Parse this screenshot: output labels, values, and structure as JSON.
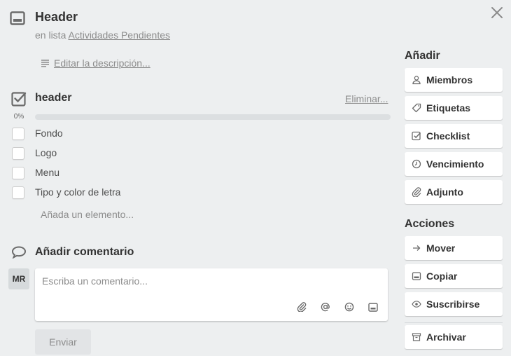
{
  "card": {
    "title": "Header",
    "in_list_prefix": "en lista",
    "list_name": "Actividades Pendientes",
    "edit_description": "Editar la descripción..."
  },
  "checklist": {
    "title": "header",
    "delete_label": "Eliminar...",
    "progress_label": "0%",
    "progress_value": 0,
    "items": [
      {
        "label": "Fondo",
        "checked": false
      },
      {
        "label": "Logo",
        "checked": false
      },
      {
        "label": "Menu",
        "checked": false
      },
      {
        "label": "Tipo y color de letra",
        "checked": false
      }
    ],
    "add_item": "Añada un elemento..."
  },
  "comment": {
    "title": "Añadir comentario",
    "avatar_initials": "MR",
    "placeholder": "Escriba un comentario...",
    "send_label": "Enviar",
    "tools": [
      "attachment-icon",
      "mention-icon",
      "emoji-icon",
      "card-icon"
    ]
  },
  "sidebar": {
    "add_title": "Añadir",
    "add_buttons": [
      {
        "label": "Miembros",
        "icon": "person-icon"
      },
      {
        "label": "Etiquetas",
        "icon": "label-icon"
      },
      {
        "label": "Checklist",
        "icon": "checklist-icon"
      },
      {
        "label": "Vencimiento",
        "icon": "clock-icon"
      },
      {
        "label": "Adjunto",
        "icon": "attachment-icon"
      }
    ],
    "actions_title": "Acciones",
    "action_buttons": [
      {
        "label": "Mover",
        "icon": "arrow-right-icon"
      },
      {
        "label": "Copiar",
        "icon": "card-icon"
      },
      {
        "label": "Suscribirse",
        "icon": "eye-icon"
      },
      {
        "label": "Archivar",
        "icon": "archive-icon"
      }
    ]
  },
  "colors": {
    "background": "#edeff0",
    "progress_fill": "#5aac44"
  }
}
